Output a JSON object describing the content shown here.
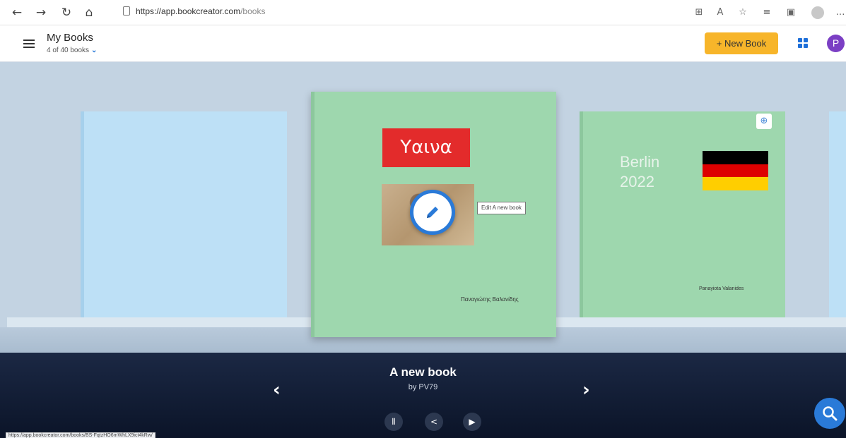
{
  "browser": {
    "url_host": "https://app.bookcreator.com",
    "url_path": "/books",
    "icons": [
      "back-icon",
      "forward-icon",
      "refresh-icon",
      "home-icon",
      "split-screen-icon",
      "read-aloud-icon",
      "favorite-icon",
      "favorites-icon",
      "collections-icon",
      "profile-icon",
      "more-icon"
    ]
  },
  "header": {
    "title": "My Books",
    "subtitle": "4 of 40 books",
    "new_book_label": "+ New Book",
    "avatar_initial": "P"
  },
  "books": {
    "center": {
      "title_text": "Υαινα",
      "author": "Παναγιώτης Βαλανίδης",
      "edit_tooltip": "Edit A new book"
    },
    "right": {
      "title_line1": "Berlin",
      "title_line2": "2022",
      "author": "Panayiota Valanides",
      "flag_colors": [
        "#000000",
        "#dd0000",
        "#ffce00"
      ]
    }
  },
  "selected": {
    "title": "A new book",
    "byline": "by PV79"
  },
  "status_url": "https://app.bookcreator.com/books/BS-FqtzHO6mWhLX9ict4kRw/",
  "colors": {
    "accent": "#2a7ad8",
    "new_book_bg": "#f7b52a",
    "avatar_bg": "#7b3fc4",
    "cover_green": "#9ed7ae",
    "cover_blue": "#bde0f6",
    "bottom_bar": "#0f1a33"
  }
}
